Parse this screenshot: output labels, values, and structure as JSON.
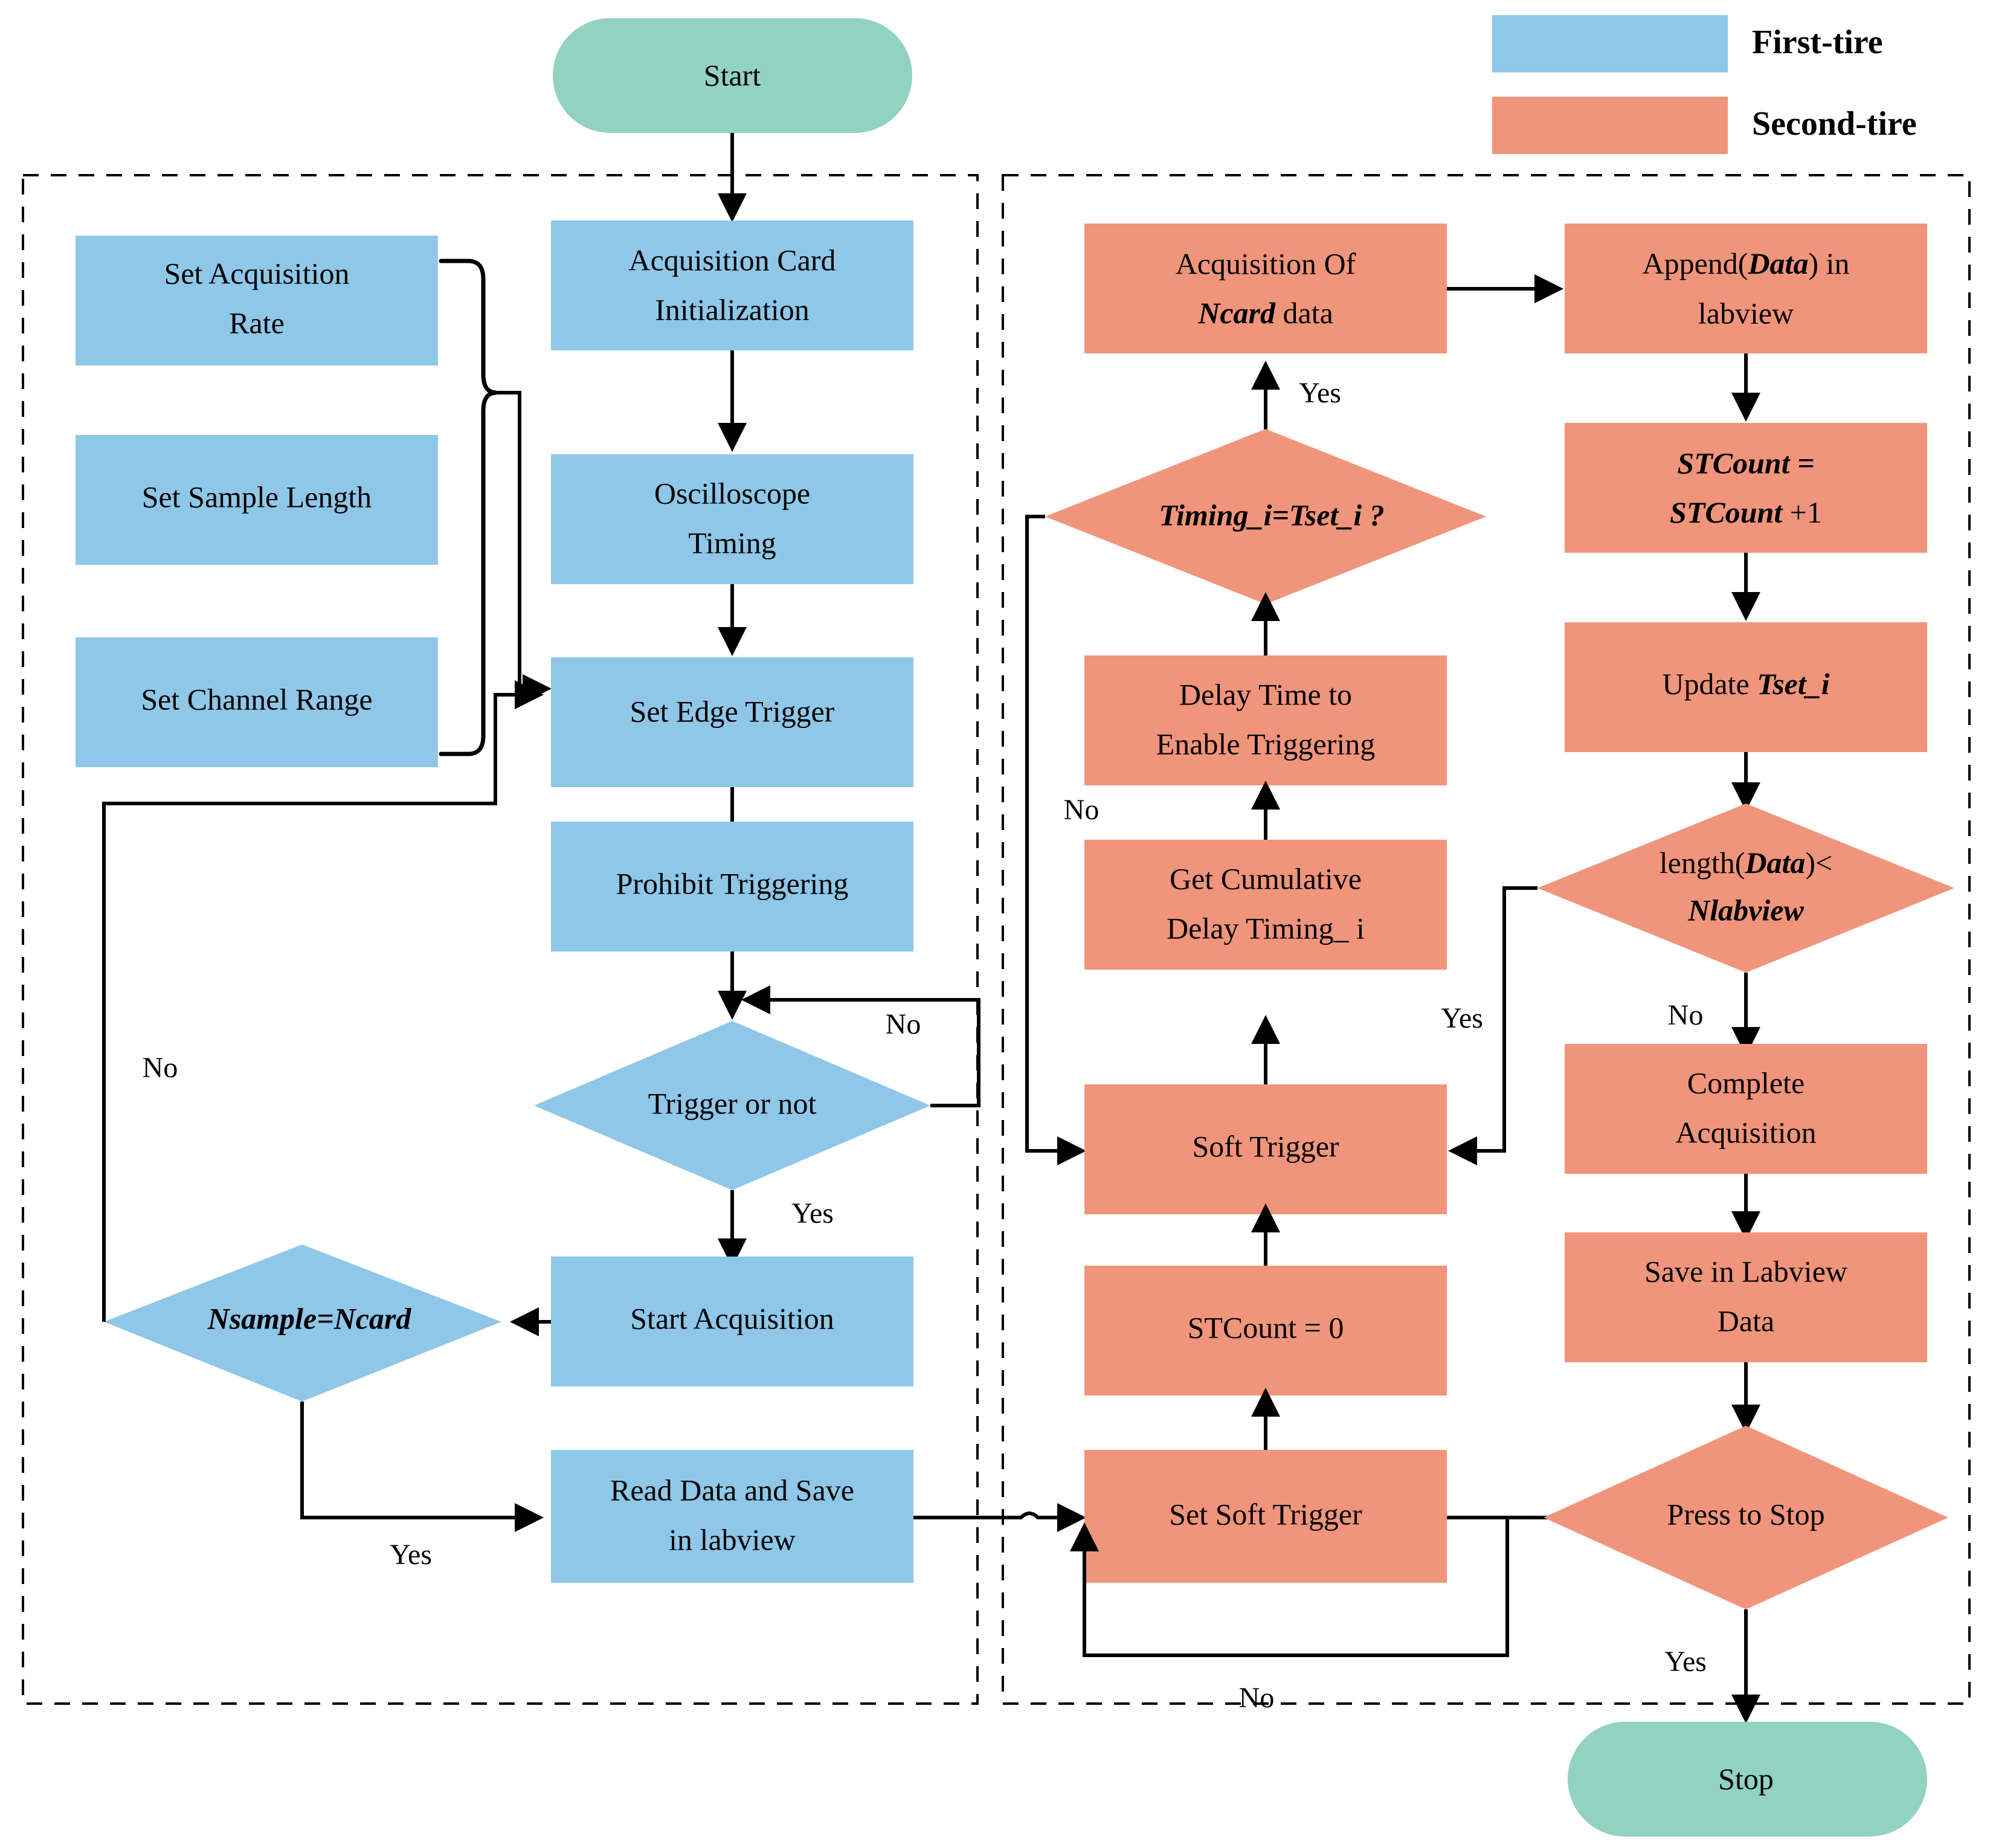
{
  "legend": {
    "items": [
      {
        "label": "First-tire",
        "color": "#8FC7E8"
      },
      {
        "label": "Second-tire",
        "color": "#F0957B"
      }
    ]
  },
  "colors": {
    "first_tire": "#8FC7E8",
    "second_tire": "#F0957B",
    "terminator": "#92D2C0",
    "stroke": "#000000",
    "background": "#FFFFFF"
  },
  "terminators": {
    "start": "Start",
    "stop": "Stop"
  },
  "left_panel": {
    "name": "First-tire acquisition loop",
    "param_nodes": [
      {
        "id": "set-acquisition-rate",
        "line1": "Set Acquisition",
        "line2": "Rate"
      },
      {
        "id": "set-sample-length",
        "line1": "Set Sample Length",
        "line2": ""
      },
      {
        "id": "set-channel-range",
        "line1": "Set Channel Range",
        "line2": ""
      }
    ],
    "process_nodes": [
      {
        "id": "acquisition-card-initialization",
        "line1": "Acquisition Card",
        "line2": "Initialization"
      },
      {
        "id": "oscilloscope-timing",
        "line1": "Oscilloscope",
        "line2": "Timing"
      },
      {
        "id": "set-edge-trigger",
        "line1": "Set Edge Trigger",
        "line2": ""
      },
      {
        "id": "prohibit-triggering",
        "line1": "Prohibit Triggering",
        "line2": ""
      },
      {
        "id": "start-acquisition",
        "line1": "Start Acquisition",
        "line2": ""
      },
      {
        "id": "read-data-and-save-in-labview",
        "line1": "Read Data and Save",
        "line2": "in labview"
      }
    ],
    "decision_nodes": [
      {
        "id": "trigger-or-not",
        "text": "Trigger or not",
        "style": "normal"
      },
      {
        "id": "nsample-equals-ncard",
        "text": "Nsample=Ncard",
        "style": "bold-italic"
      }
    ],
    "edge_labels": [
      {
        "id": "trigger-no",
        "text": "No"
      },
      {
        "id": "trigger-yes",
        "text": "Yes"
      },
      {
        "id": "nsample-no",
        "text": "No"
      },
      {
        "id": "nsample-yes",
        "text": "Yes"
      }
    ]
  },
  "right_panel": {
    "name": "Second-tire soft trigger loop",
    "mid_column": [
      {
        "id": "acquisition-of-ncard-data",
        "line1": "Acquisition Of",
        "line2": "Ncard data",
        "emph2": "Ncard"
      },
      {
        "id": "delay-time-to-enable-triggering",
        "line1": "Delay Time to",
        "line2": "Enable Triggering"
      },
      {
        "id": "get-cumulative-delay-timing-i",
        "line1": "Get Cumulative",
        "line2": "Delay Timing_ i"
      },
      {
        "id": "soft-trigger",
        "line1": "Soft Trigger",
        "line2": ""
      },
      {
        "id": "stcount-equals-zero",
        "line1": "STCount = 0",
        "line2": ""
      },
      {
        "id": "set-soft-trigger",
        "line1": "Set Soft Trigger",
        "line2": ""
      }
    ],
    "right_column": [
      {
        "id": "append-data-in-labview",
        "line1": "Append(Data) in",
        "line2": "labview"
      },
      {
        "id": "stcount-increment",
        "line1": "STCount =",
        "line2": "STCount +1"
      },
      {
        "id": "update-tset-i",
        "line1": "Update Tset_i",
        "line2": ""
      },
      {
        "id": "complete-acquisition",
        "line1": "Complete",
        "line2": "Acquisition"
      },
      {
        "id": "save-in-labview-data",
        "line1": "Save in Labview",
        "line2": "Data"
      }
    ],
    "decision_nodes": [
      {
        "id": "timing-i-equals-tset-i",
        "text": "Timing_i=Tset_i ?",
        "style": "bold-italic"
      },
      {
        "id": "length-data-less-nlabview",
        "line1": "length(Data)<",
        "line2": "Nlabview"
      },
      {
        "id": "press-to-stop",
        "text": "Press to Stop",
        "style": "normal"
      }
    ],
    "edge_labels": [
      {
        "id": "timing-yes",
        "text": "Yes"
      },
      {
        "id": "timing-no",
        "text": "No"
      },
      {
        "id": "length-yes",
        "text": "Yes"
      },
      {
        "id": "length-no",
        "text": "No"
      },
      {
        "id": "press-no",
        "text": "No"
      },
      {
        "id": "press-yes",
        "text": "Yes"
      }
    ]
  }
}
